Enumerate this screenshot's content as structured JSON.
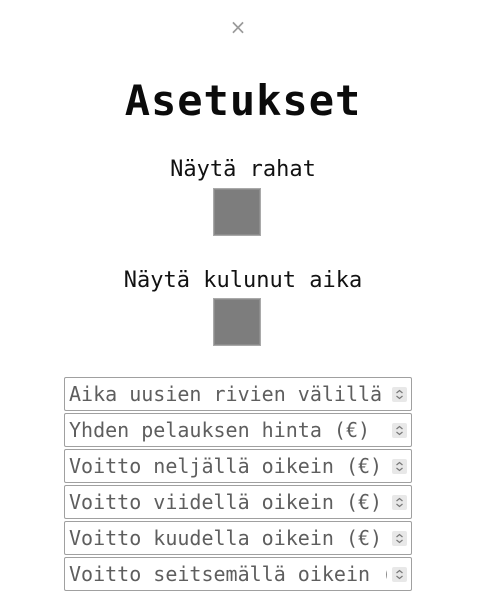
{
  "dialog": {
    "close_symbol": "×",
    "title": "Asetukset"
  },
  "options": {
    "show_money_label": "Näytä rahat",
    "show_money_checked": false,
    "show_elapsed_label": "Näytä kulunut aika",
    "show_elapsed_checked": false
  },
  "fields": [
    {
      "placeholder": "Aika uusien rivien välillä (s)",
      "value": ""
    },
    {
      "placeholder": "Yhden pelauksen hinta (€)",
      "value": ""
    },
    {
      "placeholder": "Voitto neljällä oikein (€)",
      "value": ""
    },
    {
      "placeholder": "Voitto viidellä oikein (€)",
      "value": ""
    },
    {
      "placeholder": "Voitto kuudella oikein (€)",
      "value": ""
    },
    {
      "placeholder": "Voitto seitsemällä oikein (€)",
      "value": ""
    }
  ],
  "icons": {
    "close": "close-icon",
    "spinner": "spinner-arrows-icon"
  }
}
